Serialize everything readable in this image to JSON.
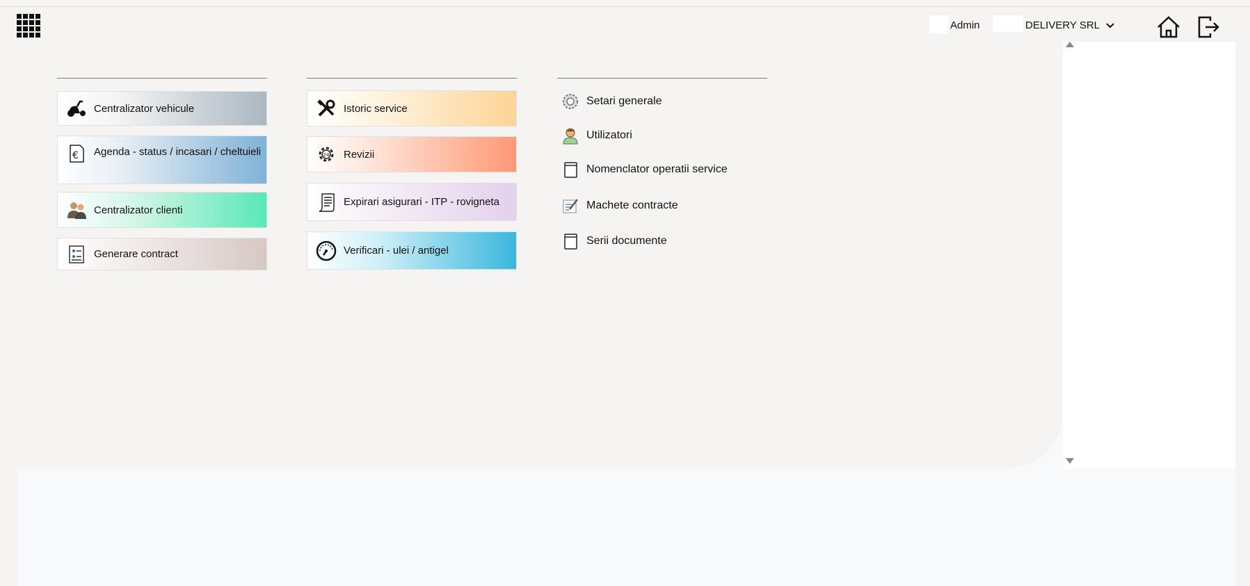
{
  "header": {
    "user_name": "Admin",
    "company": "DELIVERY SRL",
    "icons": [
      "apps-grid-icon",
      "chevron-down-icon",
      "home-icon",
      "logout-icon"
    ]
  },
  "column1": {
    "tiles": [
      {
        "label": "Centralizator vehicule",
        "icon": "scooter-icon",
        "color": "#aab8c2"
      },
      {
        "label": "Agenda - status / incasari / cheltuieli",
        "icon": "euro-document-icon",
        "color": "#7fb2d8"
      },
      {
        "label": "Centralizator clienti",
        "icon": "people-icon",
        "color": "#58e8b8"
      },
      {
        "label": "Generare contract",
        "icon": "contract-icon",
        "color": "#d7c8c4"
      }
    ]
  },
  "column2": {
    "tiles": [
      {
        "label": "Istoric service",
        "icon": "tools-icon",
        "color": "#fcd496"
      },
      {
        "label": "Revizii",
        "icon": "gear-icon",
        "color": "#ff9876"
      },
      {
        "label": "Expirari asigurari - ITP - rovigneta",
        "icon": "scroll-icon",
        "color": "#e4d1ec"
      },
      {
        "label": "Verificari - ulei / antigel",
        "icon": "gauge-icon",
        "color": "#3bb6dd"
      }
    ]
  },
  "column3": {
    "links": [
      {
        "label": "Setari generale",
        "icon": "settings-gear-icon"
      },
      {
        "label": "Utilizatori",
        "icon": "user-icon"
      },
      {
        "label": "Nomenclator operatii service",
        "icon": "book-icon"
      },
      {
        "label": "Machete contracte",
        "icon": "edit-document-icon"
      },
      {
        "label": "Serii documente",
        "icon": "book-icon"
      }
    ]
  }
}
